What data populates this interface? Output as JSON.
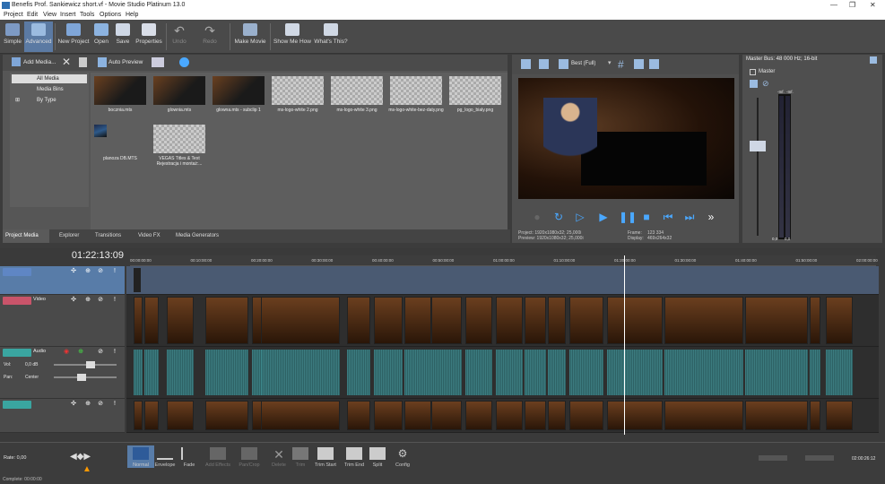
{
  "window": {
    "title": "Benefis Prof. Sankiewicz short.vf - Movie Studio Platinum 13.0"
  },
  "menu": [
    "Project",
    "Edit",
    "View",
    "Insert",
    "Tools",
    "Options",
    "Help"
  ],
  "toolbar": {
    "items": [
      "Simple",
      "Advanced",
      "New Project",
      "Open",
      "Save",
      "Properties",
      "Undo",
      "Redo",
      "Make Movie",
      "Show Me How",
      "What's This?"
    ]
  },
  "explorer": {
    "add_media": "Add Media...",
    "auto_preview": "Auto Preview",
    "tree": [
      "All Media",
      "Media Bins",
      "By Type"
    ],
    "media": [
      "bocznia.mts",
      "glownia.mts",
      "glowna.mts - subclip 1",
      "ms-logo-white 2.png",
      "ms-logo-white 3.png",
      "ms-logo-white-bez-daty.png",
      "pg_logo_bialy.png",
      "planoza DB.MTS",
      "VEGAS Titles & Text Rejestracja i montaż:..."
    ],
    "tabs": [
      "Project Media",
      "Explorer",
      "Transitions",
      "Video FX",
      "Media Generators"
    ]
  },
  "preview": {
    "quality": "Best (Full)",
    "project": "Project:  1920x1080x32; 25,000i",
    "preview": "Preview:  1920x1080x32; 25,000i",
    "frame_label": "Frame:",
    "frame": "123 334",
    "display_label": "Display:",
    "display": "469x264x32"
  },
  "master": {
    "title": "Master Bus: 48 000 Hz; 16-bit",
    "label": "Master",
    "val_left": "0,0",
    "val_right": "0,0",
    "scale": [
      "-Inf.",
      "-Inf.",
      "3",
      "6",
      "9",
      "12",
      "15",
      "18",
      "21",
      "24",
      "27",
      "30",
      "33",
      "36",
      "39",
      "42",
      "45",
      "48",
      "51",
      "54",
      "57"
    ]
  },
  "timeline": {
    "counter": "01:22:13:09",
    "ruler": [
      "00:00:00:00",
      "00:10:00:00",
      "00:20:00:00",
      "00:30:00:00",
      "00:40:00:00",
      "00:50:00:00",
      "01:00:00:00",
      "01:10:00:00",
      "01:20:00:00",
      "01:30:00:00",
      "01:40:00:00",
      "01:50:00:00",
      "02:00:00:00"
    ],
    "tracks": [
      {
        "name": "",
        "color": "#5f86c4"
      },
      {
        "name": "Video",
        "color": "#c9546a"
      },
      {
        "name": "Audio",
        "color": "#3aa5a0",
        "vol_label": "Vol:",
        "vol": "0,0 dB",
        "pan_label": "Pan:",
        "pan": "Center"
      },
      {
        "name": "",
        "color": "#3aa5a0"
      }
    ]
  },
  "bottom": {
    "rate": "Rate: 0,00",
    "complete": "Complete: 00:00:00",
    "tools": [
      "Normal",
      "Envelope",
      "Fade",
      "Add Effects",
      "Pan/Crop",
      "Delete",
      "Trim",
      "Trim Start",
      "Trim End",
      "Split",
      "Config"
    ],
    "end_time": "02:00:26:12"
  }
}
